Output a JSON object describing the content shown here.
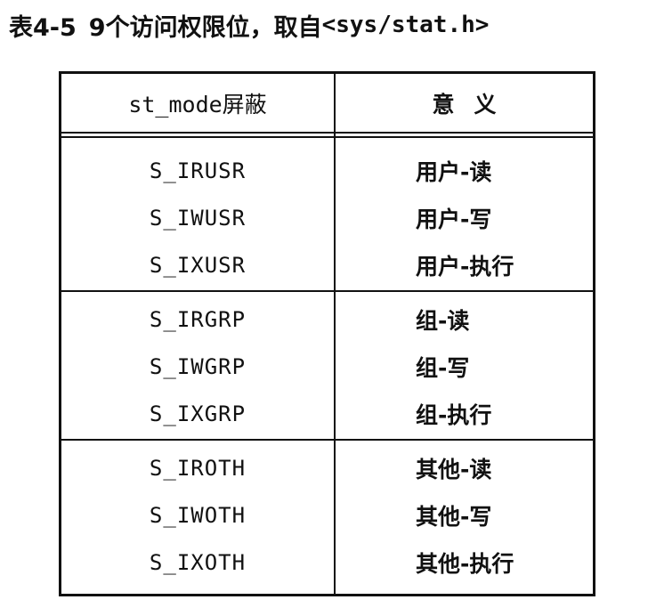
{
  "caption": {
    "number": "表4-5",
    "text": "9个访问权限位，取自",
    "header_file": "<sys/stat.h>"
  },
  "table": {
    "headers": [
      "st_mode屏蔽",
      "意义"
    ],
    "rows": [
      [
        "S_IRUSR",
        "用户-读"
      ],
      [
        "S_IWUSR",
        "用户-写"
      ],
      [
        "S_IXUSR",
        "用户-执行"
      ],
      [
        "S_IRGRP",
        "组-读"
      ],
      [
        "S_IWGRP",
        "组-写"
      ],
      [
        "S_IXGRP",
        "组-执行"
      ],
      [
        "S_IROTH",
        "其他-读"
      ],
      [
        "S_IWOTH",
        "其他-写"
      ],
      [
        "S_IXOTH",
        "其他-执行"
      ]
    ]
  }
}
